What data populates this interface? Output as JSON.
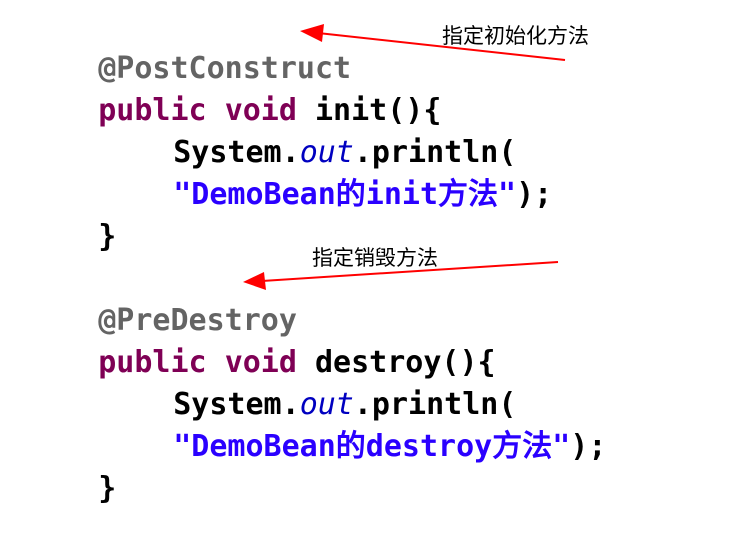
{
  "block1": {
    "annotation": "@PostConstruct",
    "signature": {
      "kw1": "public",
      "kw2": "void",
      "name": "init(){"
    },
    "call": {
      "prefix": "System.",
      "field": "out",
      "suffix": ".println("
    },
    "string": "\"DemoBean的init方法\"",
    "string_end": ");",
    "close": "}"
  },
  "block2": {
    "annotation": "@PreDestroy",
    "signature": {
      "kw1": "public",
      "kw2": "void",
      "name": "destroy(){"
    },
    "call": {
      "prefix": "System.",
      "field": "out",
      "suffix": ".println("
    },
    "string": "\"DemoBean的destroy方法\"",
    "string_end": ");",
    "close": "}"
  },
  "notes": {
    "init_label": "指定初始化方法",
    "destroy_label": "指定销毁方法"
  },
  "colors": {
    "annotation": "#646464",
    "keyword": "#7f0055",
    "field": "#0000c0",
    "string": "#2a00ff",
    "arrow": "#ff0000"
  }
}
